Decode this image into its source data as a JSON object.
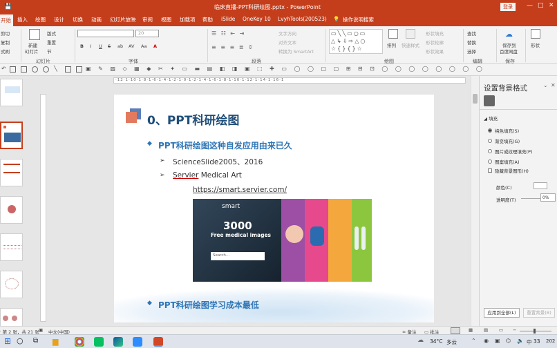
{
  "window": {
    "title": "临床直播-PPT科研绘图.pptx  -  PowerPoint",
    "login_label": "登录",
    "controls": [
      "—",
      "□",
      "✕"
    ]
  },
  "tabs": [
    {
      "label": "开始",
      "active": true
    },
    {
      "label": "插入"
    },
    {
      "label": "绘图"
    },
    {
      "label": "设计"
    },
    {
      "label": "切换"
    },
    {
      "label": "动画"
    },
    {
      "label": "幻灯片放映"
    },
    {
      "label": "审阅"
    },
    {
      "label": "视图"
    },
    {
      "label": "加载项"
    },
    {
      "label": "帮助"
    },
    {
      "label": "iSlide"
    },
    {
      "label": "OneKey 10"
    },
    {
      "label": "LvyhTools(200523)"
    },
    {
      "label": "操作说明搜索"
    }
  ],
  "ribbon": {
    "clipboard": {
      "cut": "剪切",
      "copy": "复制",
      "format_painter": "式刷"
    },
    "slides": {
      "new_slide": "新建",
      "new_slide_2": "幻灯片",
      "layout": "版式",
      "reset": "重置",
      "section": "节",
      "group": "幻灯片"
    },
    "font": {
      "group": "字体",
      "size": "20",
      "buttons": [
        "B",
        "I",
        "U",
        "S",
        "ab",
        "AV",
        "Aa",
        "A"
      ]
    },
    "paragraph": {
      "group": "段落",
      "text_direction": "文字方向",
      "align_text": "对齐文本",
      "smartart": "转换为 SmartArt"
    },
    "drawing": {
      "group": "绘图",
      "arrange": "排列",
      "quick_styles": "快速样式",
      "shape_fill": "形状填充",
      "shape_outline": "形状轮廓",
      "shape_effects": "形状效果"
    },
    "editing": {
      "group": "编辑",
      "find": "查找",
      "replace": "替换",
      "select": "选择"
    },
    "save": {
      "group": "保存",
      "save_to": "保存到",
      "baidu": "百度网盘"
    },
    "shape": {
      "label": "形状"
    }
  },
  "slide": {
    "title": "0、PPT科研绘图",
    "bullet1": "PPT科研绘图这种自发应用由来已久",
    "sub1": "ScienceSlide2005、2016",
    "sub2_a": "Servier",
    "sub2_b": " Medical Art",
    "link": "https://smart.servier.com/",
    "bullet2": "PPT科研绘图学习成本最低",
    "image": {
      "brand": "smart",
      "big": "3000",
      "caption": "Free medical images",
      "search": "Search..."
    }
  },
  "ruler": "·12·1·10·1·8·1·6·1·4·1·2·1·0·1·2·1·4·1·6·1·8·1·10·1·12·1·14·1·16·1",
  "thumbnails": [
    {
      "num": "1"
    },
    {
      "num": "2"
    },
    {
      "num": "3"
    },
    {
      "num": "4"
    },
    {
      "num": "5"
    },
    {
      "num": "6"
    },
    {
      "num": "7"
    }
  ],
  "pane": {
    "title": "设置背景格式",
    "fill_section": "填充",
    "options": [
      "纯色填充(S)",
      "渐变填充(G)",
      "图片或纹理填充(P)",
      "图案填充(A)"
    ],
    "hide_bg": "隐藏背景图形(H)",
    "color_label": "颜色(C)",
    "transparency_label": "透明度(T)",
    "transparency_value": "0%",
    "apply_all": "应用到全部(L)",
    "reset_bg": "重置背景(B)"
  },
  "status": {
    "slide_count": "幻灯片 第 2 张，共 21 张",
    "language": "中文(中国)",
    "notes": "备注",
    "comments": "批注"
  },
  "taskbar": {
    "weather_temp": "34°C",
    "weather_desc": "多云",
    "input_method": "中",
    "battery": "33",
    "year": "202"
  },
  "colors": {
    "accent": "#c43e1c",
    "slide_title": "#1f4e79",
    "slide_text": "#2e75b6",
    "ribbon_bg": "#f3f3f3"
  }
}
